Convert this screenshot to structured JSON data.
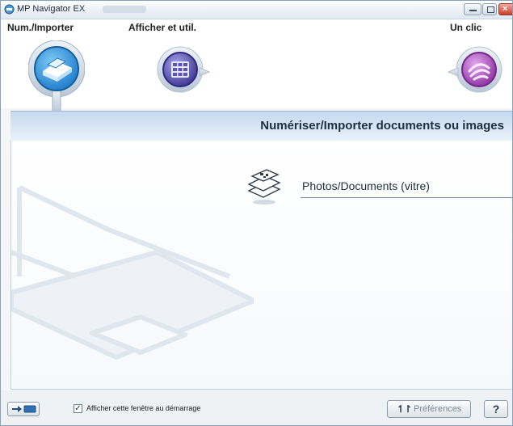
{
  "window": {
    "title": "MP Navigator EX"
  },
  "nav": {
    "tabs": [
      {
        "label": "Num./Importer"
      },
      {
        "label": "Afficher et util."
      },
      {
        "label": "Un clic"
      }
    ]
  },
  "header": {
    "title": "Numériser/Importer documents ou images"
  },
  "main": {
    "items": [
      {
        "label": "Photos/Documents (vitre)",
        "icon": "documents-stack-icon"
      }
    ]
  },
  "status": {
    "checkbox_label": "Afficher cette fenêtre au démarrage",
    "checkbox_checked": "✓",
    "preferences_label": "Préférences",
    "preferences_icon": "↿↾",
    "help_label": "?"
  },
  "colors": {
    "scan_accent": "#2a8ed6",
    "view_accent": "#5d53b5",
    "oneclick_accent": "#a54fb8",
    "header_band": "#c4d8ef"
  }
}
